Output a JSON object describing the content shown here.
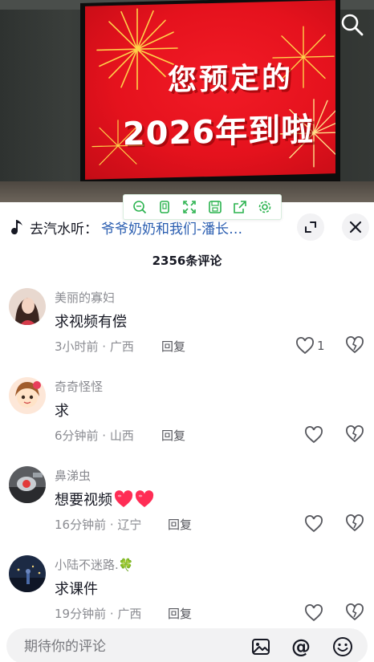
{
  "video": {
    "screen_line1": "您预定的",
    "screen_line2": "2026年到啦"
  },
  "toolbar": {
    "tools": [
      "search-plus-icon",
      "copy-icon",
      "fullscreen-icon",
      "save-icon",
      "share-icon",
      "settings-icon"
    ]
  },
  "music": {
    "prefix": "去汽水听：",
    "song": "爷爷奶奶和我们-潘长…"
  },
  "comments_header": {
    "count_text": "2356条评论"
  },
  "comments": [
    {
      "name": "美丽的寡妇",
      "text": "求视频有偿",
      "meta": "3小时前 · 广西",
      "reply": "回复",
      "likes": "1"
    },
    {
      "name": "奇奇怪怪",
      "text": "求",
      "meta": "6分钟前 · 山西",
      "reply": "回复",
      "likes": ""
    },
    {
      "name": "鼻涕虫",
      "text": "想要视频",
      "meta": "16分钟前 · 辽宁",
      "reply": "回复",
      "likes": ""
    },
    {
      "name": "小陆不迷路.🍀",
      "text": "求课件",
      "meta": "19分钟前 · 广西",
      "reply": "回复",
      "likes": ""
    }
  ],
  "input": {
    "placeholder": "期待你的评论"
  },
  "colors": {
    "accent_link": "#2a5db0",
    "toolbar_green": "#2bb34f",
    "heart_red": "#ff2d55"
  }
}
